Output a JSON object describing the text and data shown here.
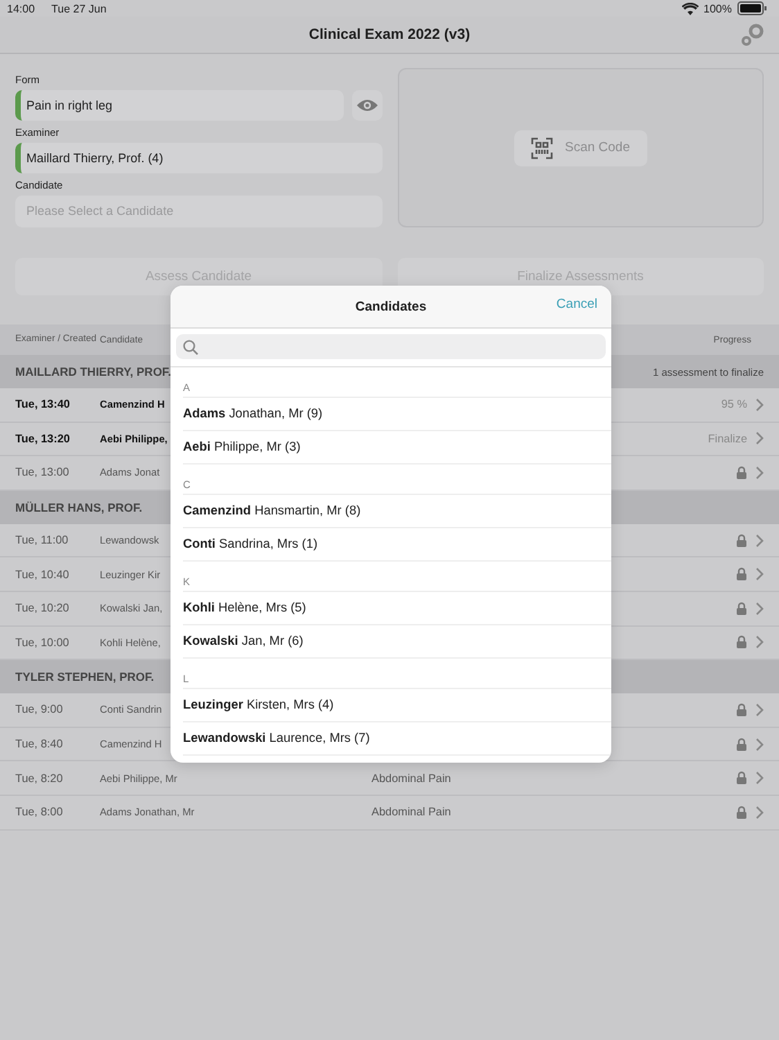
{
  "status_bar": {
    "time": "14:00",
    "date": "Tue 27 Jun",
    "battery": "100%"
  },
  "nav": {
    "title": "Clinical Exam 2022 (v3)"
  },
  "form": {
    "form_label": "Form",
    "form_value": "Pain in right leg",
    "examiner_label": "Examiner",
    "examiner_value": "Maillard Thierry, Prof. (4)",
    "candidate_label": "Candidate",
    "candidate_placeholder": "Please Select a Candidate"
  },
  "scan_button": {
    "label": "Scan Code"
  },
  "buttons": [
    {
      "label": "Assess Candidate",
      "disabled": true
    },
    {
      "label": "Finalize Assessments",
      "disabled": true
    }
  ],
  "table": {
    "columns": [
      "Examiner / Created",
      "Candidate",
      "Progress"
    ],
    "groups": [
      {
        "examiner": "MAILLARD THIERRY, PROF.",
        "summary": "1 assessment to finalize",
        "rows": [
          {
            "created": "Tue, 13:40",
            "candidate": "Camenzind H",
            "progress": "95 %",
            "locked": false,
            "active": true
          },
          {
            "created": "Tue, 13:20",
            "candidate": "Aebi Philippe,",
            "progress": "Finalize",
            "locked": false,
            "active": true
          },
          {
            "created": "Tue, 13:00",
            "candidate": "Adams Jonat",
            "locked": true,
            "active": false
          }
        ]
      },
      {
        "examiner": "MÜLLER HANS, PROF.",
        "rows": [
          {
            "created": "Tue, 11:00",
            "candidate": "Lewandowsk",
            "locked": true,
            "active": false
          },
          {
            "created": "Tue, 10:40",
            "candidate": "Leuzinger Kir",
            "locked": true,
            "active": false
          },
          {
            "created": "Tue, 10:20",
            "candidate": "Kowalski Jan,",
            "locked": true,
            "active": false
          },
          {
            "created": "Tue, 10:00",
            "candidate": "Kohli Helène,",
            "locked": true,
            "active": false
          }
        ]
      },
      {
        "examiner": "TYLER STEPHEN, PROF.",
        "rows": [
          {
            "created": "Tue, 9:00",
            "candidate": "Conti Sandrin",
            "locked": true,
            "active": false
          },
          {
            "created": "Tue, 8:40",
            "candidate": "Camenzind H",
            "locked": true,
            "active": false
          },
          {
            "created": "Tue, 8:20",
            "candidate": "Aebi Philippe, Mr",
            "form": "Abdominal Pain",
            "locked": true,
            "active": false
          },
          {
            "created": "Tue, 8:00",
            "candidate": "Adams Jonathan, Mr",
            "form": "Abdominal Pain",
            "locked": true,
            "active": false
          }
        ]
      }
    ]
  },
  "modal": {
    "title": "Candidates",
    "cancel": "Cancel",
    "sections": [
      {
        "letter": "A",
        "items": [
          "**Adams** Jonathan, Mr (9)",
          "**Aebi** Philippe, Mr (3)"
        ]
      },
      {
        "letter": "C",
        "items": [
          "**Camenzind** Hansmartin, Mr (8)",
          "**Conti** Sandrina, Mrs (1)"
        ]
      },
      {
        "letter": "K",
        "items": [
          "**Kohli** Helène, Mrs (5)",
          "**Kowalski** Jan, Mr (6)"
        ]
      },
      {
        "letter": "L",
        "items": [
          "**Leuzinger** Kirsten, Mrs (4)",
          "**Lewandowski** Laurence, Mrs (7)"
        ]
      }
    ]
  }
}
